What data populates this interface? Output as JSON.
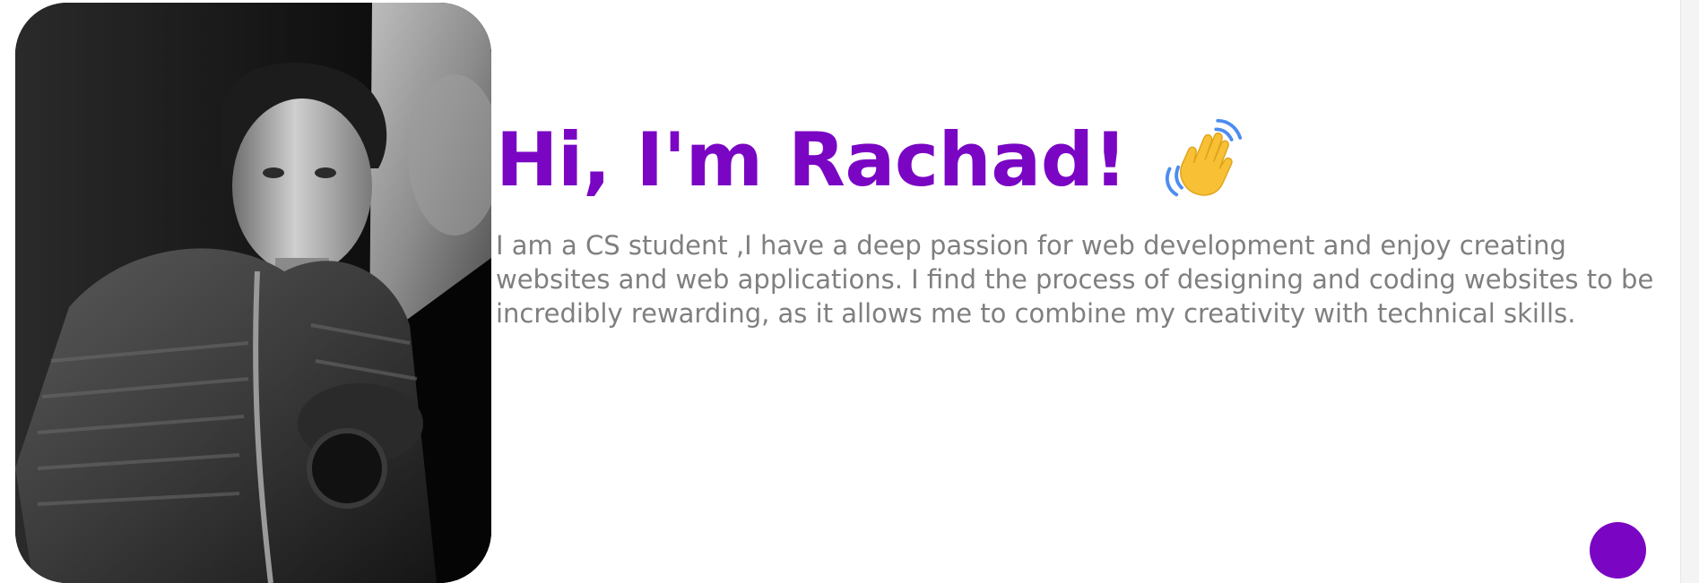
{
  "hero": {
    "greeting": "Hi, I'm Rachad!",
    "intro": "I am a CS student ,I have a deep passion for web development and enjoy creating websites and web applications. I find the process of designing and coding websites to be incredibly rewarding, as it allows me to combine my creativity with technical skills."
  },
  "icons": {
    "wave": "waving-hand-icon"
  },
  "colors": {
    "accent": "#7a06c4",
    "body_text": "#7f7f7f",
    "background": "#ffffff"
  }
}
